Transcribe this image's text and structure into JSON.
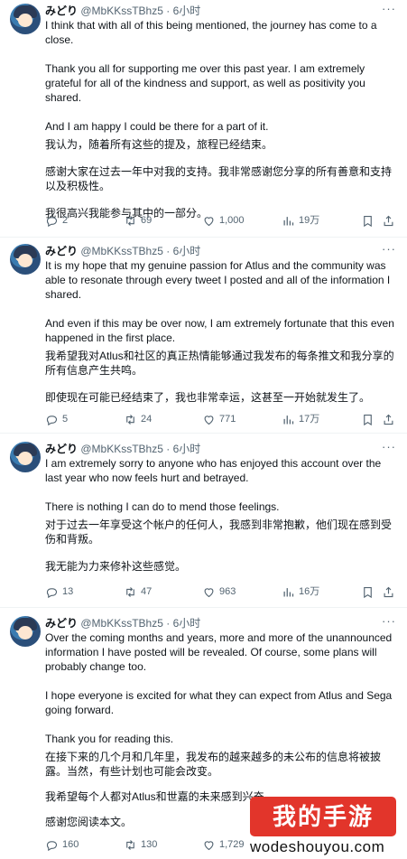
{
  "tweets": [
    {
      "author": "みどり",
      "handle": "@MbKKssTBhz5",
      "time": "· 6小时",
      "paragraphs": [
        "I think that with all of this being mentioned, the journey has come to a close.",
        "Thank you all for supporting me over this past year. I am extremely grateful for all of the kindness and support, as well as positivity you shared.",
        "And I am happy I could be there for a part of it.",
        "我认为，随着所有这些的提及，旅程已经结束。",
        "感谢大家在过去一年中对我的支持。我非常感谢您分享的所有善意和支持以及积极性。",
        "我很高兴我能参与其中的一部分。"
      ],
      "replies": "2",
      "reposts": "69",
      "likes": "1,000",
      "views": "19万"
    },
    {
      "author": "みどり",
      "handle": "@MbKKssTBhz5",
      "time": "· 6小时",
      "paragraphs": [
        "It is my hope that my genuine passion for Atlus and the community was able to resonate through every tweet I posted and all of the information I shared.",
        "And even if this may be over now, I am extremely fortunate that this even happened in the first place.",
        "我希望我对Atlus和社区的真正热情能够通过我发布的每条推文和我分享的所有信息产生共鸣。",
        "即使现在可能已经结束了，我也非常幸运，这甚至一开始就发生了。"
      ],
      "replies": "5",
      "reposts": "24",
      "likes": "771",
      "views": "17万"
    },
    {
      "author": "みどり",
      "handle": "@MbKKssTBhz5",
      "time": "· 6小时",
      "paragraphs": [
        "I am extremely sorry to anyone who has enjoyed this account over the last year who now feels hurt and betrayed.",
        "There is nothing I can do to mend those feelings.",
        "对于过去一年享受这个帐户的任何人，我感到非常抱歉，他们现在感到受伤和背叛。",
        "我无能为力来修补这些感觉。"
      ],
      "replies": "13",
      "reposts": "47",
      "likes": "963",
      "views": "16万"
    },
    {
      "author": "みどり",
      "handle": "@MbKKssTBhz5",
      "time": "· 6小时",
      "paragraphs": [
        "Over the coming months and years, more and more of the unannounced information I have posted will be revealed. Of course, some plans will probably change too.",
        "I hope everyone is excited for what they can expect from Atlus and Sega going forward.",
        "Thank you for reading this.",
        "在接下来的几个月和几年里，我发布的越来越多的未公布的信息将被披露。当然，有些计划也可能会改变。",
        "我希望每个人都对Atlus和世嘉的未来感到兴奋",
        "感谢您阅读本文。"
      ],
      "replies": "160",
      "reposts": "130",
      "likes": "1,729",
      "views": ""
    }
  ],
  "watermark": {
    "badge": "我的手游",
    "url": "wodeshouyou.com"
  },
  "icons": {
    "reply": "reply-icon",
    "repost": "repost-icon",
    "like": "heart-icon",
    "views": "views-icon",
    "bookmark": "bookmark-icon",
    "share": "share-icon",
    "more": "more-icon"
  },
  "colors": {
    "text": "#0f1419",
    "secondary": "#536471",
    "divider": "#eff3f4",
    "watermark": "#e2352b"
  }
}
